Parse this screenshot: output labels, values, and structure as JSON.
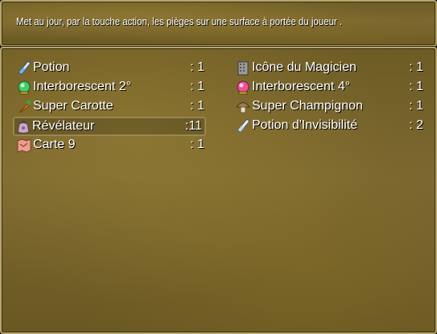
{
  "help": {
    "text": "Met au jour, par la touche action, les pièges sur une surface à portée du joueur ."
  },
  "items": [
    {
      "name": "Potion",
      "count": ": 1",
      "icon": "potion-icon"
    },
    {
      "name": "Icône du Magicien",
      "count": ": 1",
      "icon": "magician-book-icon"
    },
    {
      "name": "Interborescent 2°",
      "count": ": 1",
      "icon": "green-orb-icon"
    },
    {
      "name": "Interborescent 4°",
      "count": ": 1",
      "icon": "pink-orb-icon"
    },
    {
      "name": "Super Carotte",
      "count": ": 1",
      "icon": "carrot-icon"
    },
    {
      "name": "Super Champignon",
      "count": ": 1",
      "icon": "mushroom-icon"
    },
    {
      "name": "Révélateur",
      "count": ":11",
      "icon": "bag-icon",
      "selected": true
    },
    {
      "name": "Potion d'Invisibilité",
      "count": ": 2",
      "icon": "potion-icon"
    },
    {
      "name": "Carte 9",
      "count": ": 1",
      "icon": "map-icon"
    }
  ]
}
